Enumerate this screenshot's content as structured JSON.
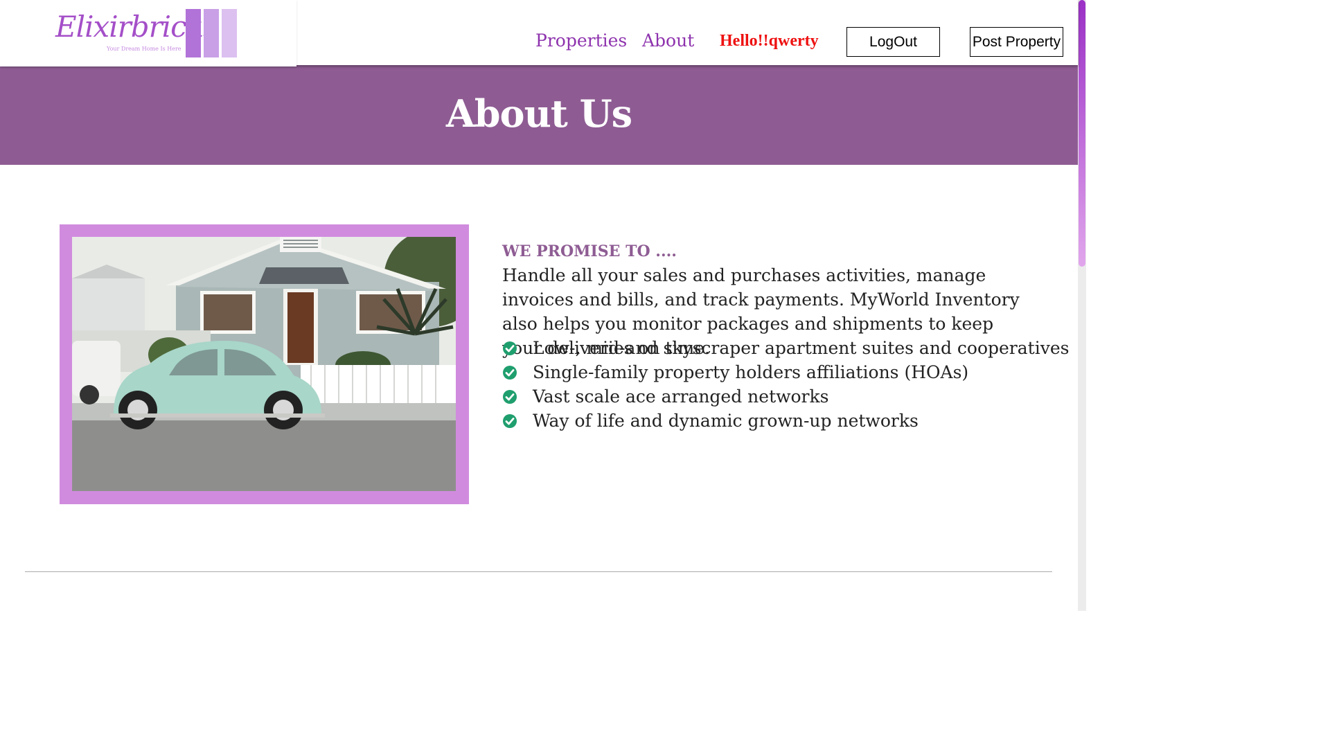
{
  "header": {
    "logo_text": "Elixirbricks",
    "logo_tagline": "Your Dream Home Is Here",
    "nav": {
      "properties": "Properties",
      "about": "About"
    },
    "greeting": "Hello!!qwerty",
    "logout_label": "LogOut",
    "post_property_label": "Post Property"
  },
  "banner": {
    "title": "About Us"
  },
  "photo": {
    "frame_color": "#d08bde"
  },
  "promise": {
    "heading": "WE PROMISE TO ....",
    "body": "Handle all your sales and purchases activities, manage invoices and bills, and track payments. MyWorld Inventory also helps you monitor packages and shipments to keep your deliveries on time.",
    "items": [
      "Low-, mid-and skyscraper apartment suites and cooperatives",
      "Single-family property holders affiliations (HOAs)",
      "Vast scale ace arranged networks",
      "Way of life and dynamic grown-up networks"
    ]
  },
  "colors": {
    "brand_purple": "#8e33ae",
    "banner_purple": "#8e5c93",
    "greeting_red": "#ee1111",
    "check_green": "#1f9e6e"
  }
}
